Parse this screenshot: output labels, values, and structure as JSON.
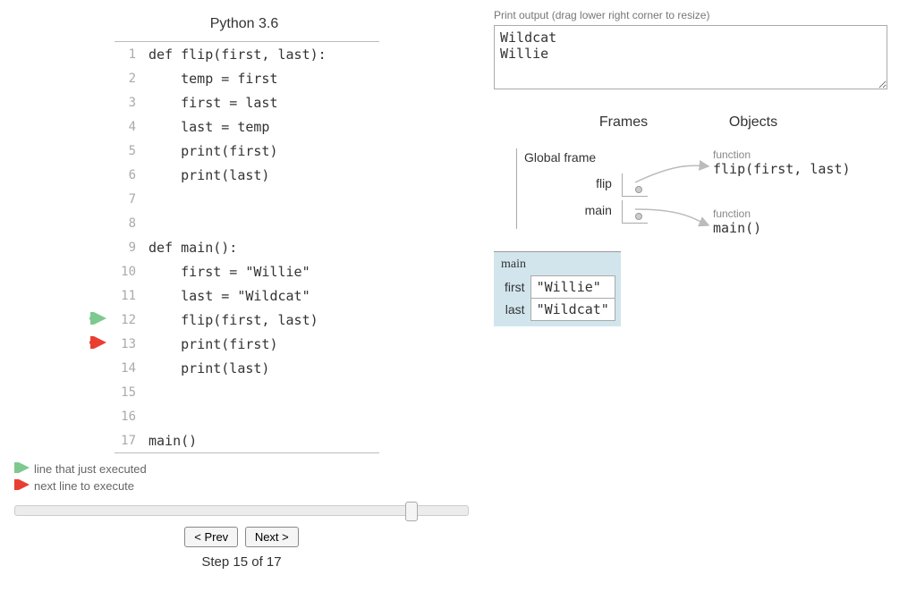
{
  "language": "Python 3.6",
  "code_lines": [
    "def flip(first, last):",
    "    temp = first",
    "    first = last",
    "    last = temp",
    "    print(first)",
    "    print(last)",
    "",
    "",
    "def main():",
    "    first = \"Willie\"",
    "    last = \"Wildcat\"",
    "    flip(first, last)",
    "    print(first)",
    "    print(last)",
    "",
    "",
    "main()"
  ],
  "just_executed_line": 12,
  "next_line": 13,
  "legend": {
    "just": "line that just executed",
    "next": "next line to execute"
  },
  "buttons": {
    "prev": "< Prev",
    "next": "Next >"
  },
  "step_label": "Step 15 of 17",
  "current_step": 15,
  "total_steps": 17,
  "output_label": "Print output (drag lower right corner to resize)",
  "print_output": "Wildcat\nWillie",
  "headers": {
    "frames": "Frames",
    "objects": "Objects"
  },
  "global_frame": {
    "title": "Global frame",
    "vars": [
      {
        "name": "flip"
      },
      {
        "name": "main"
      }
    ]
  },
  "objects": [
    {
      "type": "function",
      "repr": "flip(first, last)"
    },
    {
      "type": "function",
      "repr": "main()"
    }
  ],
  "main_frame": {
    "title": "main",
    "vars": [
      {
        "name": "first",
        "value": "\"Willie\""
      },
      {
        "name": "last",
        "value": "\"Wildcat\""
      }
    ]
  },
  "colors": {
    "just_arrow": "#7ec98f",
    "next_arrow": "#e93f33"
  }
}
